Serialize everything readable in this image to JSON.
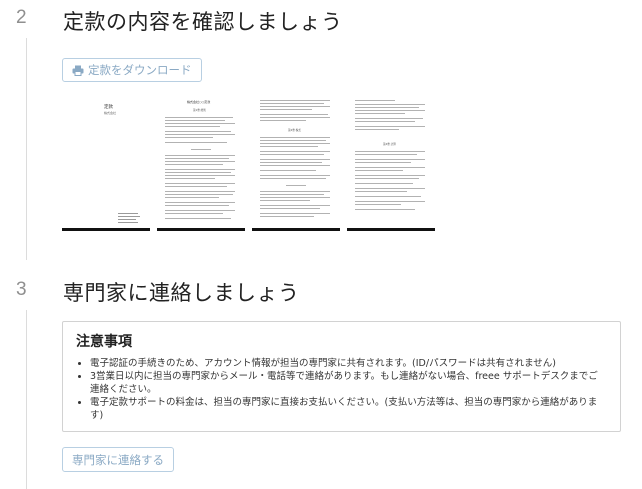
{
  "step2": {
    "number": "2",
    "title": "定款の内容を確認しましょう",
    "download_label": "定款をダウンロード",
    "pages": [
      {
        "heading": "定款",
        "sub": "株式会社"
      },
      {
        "heading": "株式会社○○定款",
        "sub": "第1章 総則"
      },
      {
        "heading": "",
        "sub": "第2章 株式"
      },
      {
        "heading": "",
        "sub": "第4章 計算"
      }
    ]
  },
  "step3": {
    "number": "3",
    "title": "専門家に連絡しましょう",
    "notice": {
      "title": "注意事項",
      "items": [
        "電子認証の手続きのため、アカウント情報が担当の専門家に共有されます。(ID/パスワードは共有されません)",
        "3営業日以内に担当の専門家からメール・電話等で連絡があります。もし連絡がない場合、freee サポートデスクまでご連絡ください。",
        "電子定款サポートの料金は、担当の専門家に直接お支払いください。(支払い方法等は、担当の専門家から連絡があります)"
      ]
    },
    "contact_label": "専門家に連絡する"
  },
  "colors": {
    "button_border": "#b8cfe2",
    "button_text": "#8aa9c4",
    "step_number": "#8f8f8f"
  }
}
